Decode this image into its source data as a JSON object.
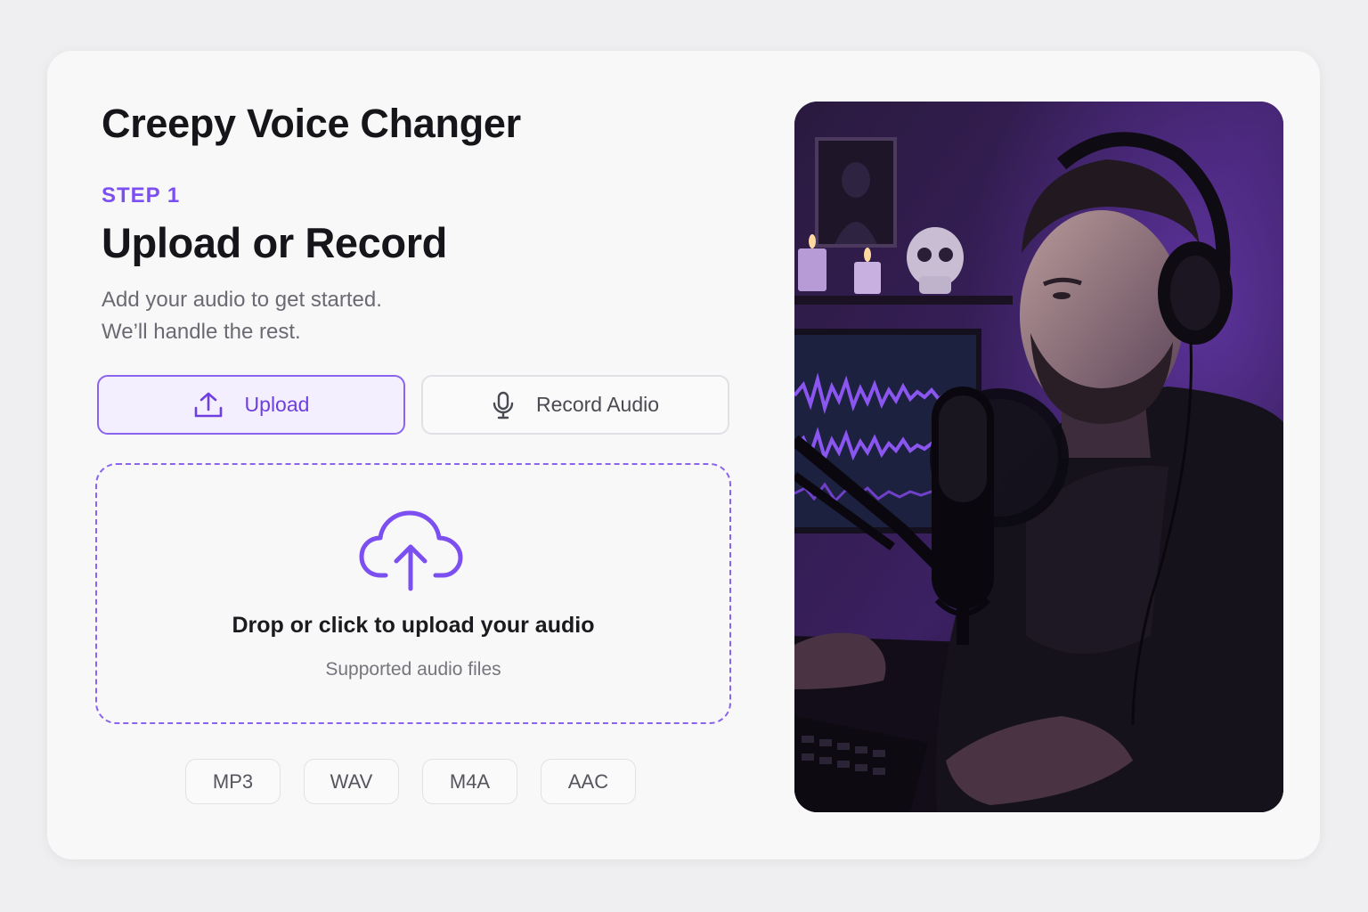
{
  "app": {
    "title": "Creepy Voice Changer"
  },
  "step": {
    "label": "STEP 1",
    "title": "Upload or Record",
    "subtitle_line1": "Add your audio to get started.",
    "subtitle_line2": "We’ll handle the rest."
  },
  "modes": {
    "upload_label": "Upload",
    "record_label": "Record Audio",
    "active": "upload"
  },
  "dropzone": {
    "title": "Drop or click to upload your audio",
    "subtitle": "Supported audio files",
    "icon": "cloud-upload-icon"
  },
  "formats": [
    "MP3",
    "WAV",
    "M4A",
    "AAC"
  ],
  "colors": {
    "accent": "#7c4ff0",
    "accent_light": "#f4effe",
    "background": "#efeff1",
    "card": "#f8f8f9",
    "text": "#16161a"
  }
}
